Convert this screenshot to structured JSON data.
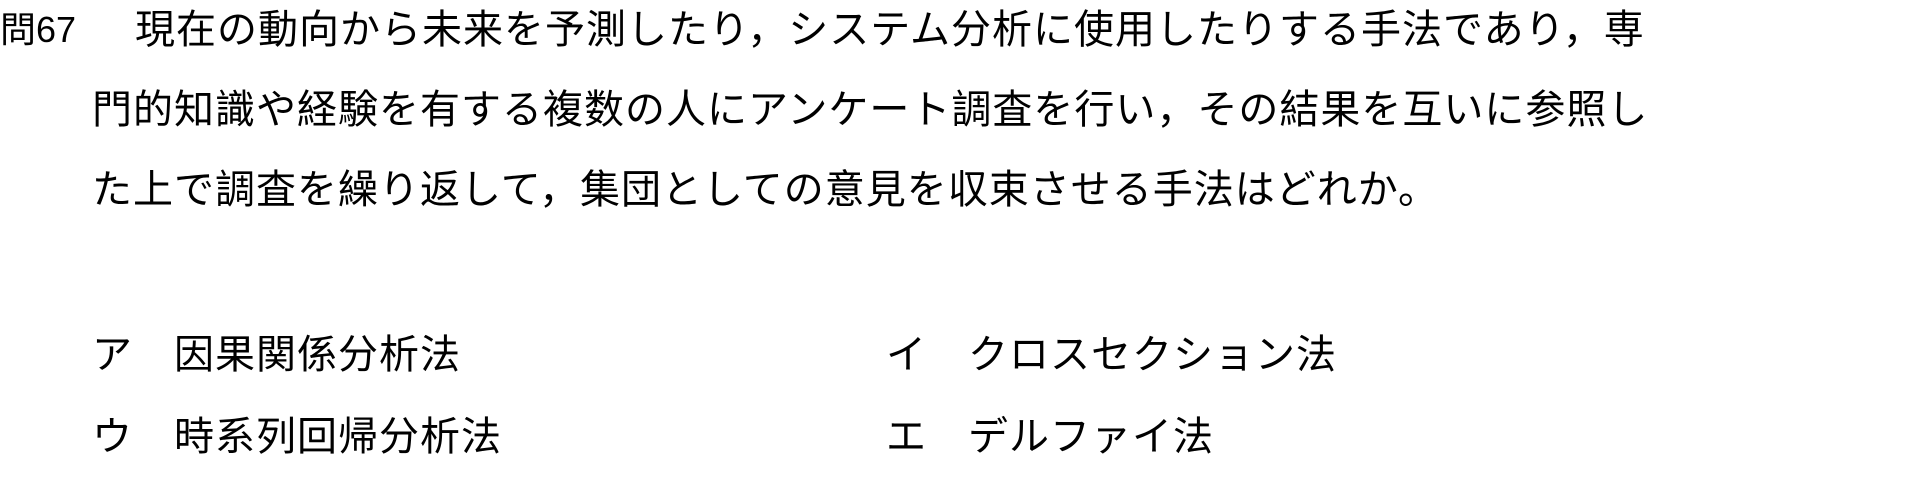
{
  "question": {
    "number": "問67",
    "lines": [
      "現在の動向から未来を予測したり，システム分析に使用したりする手法であり，専",
      "門的知識や経験を有する複数の人にアンケート調査を行い，その結果を互いに参照し",
      "た上で調査を繰り返して，集団としての意見を収束させる手法はどれか。"
    ]
  },
  "options": [
    {
      "label": "ア",
      "text": "因果関係分析法"
    },
    {
      "label": "イ",
      "text": "クロスセクション法"
    },
    {
      "label": "ウ",
      "text": "時系列回帰分析法"
    },
    {
      "label": "エ",
      "text": "デルファイ法"
    }
  ]
}
